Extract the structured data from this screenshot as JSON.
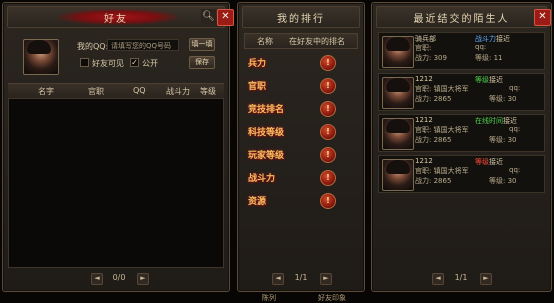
{
  "friends_panel": {
    "title": "好友",
    "search_icon": "search-icon",
    "close_label": "✕",
    "qq_label": "我的QQ:",
    "qq_placeholder": "请填写您的QQ号码",
    "fill_button": "填一填",
    "save_button": "保存",
    "friends_visible_label": "好友可见",
    "public_label": "公开",
    "public_checked": "✓",
    "columns": [
      "名字",
      "官职",
      "QQ",
      "战斗力",
      "等级"
    ],
    "pager": {
      "prev": "◄",
      "text": "0/0",
      "next": "►"
    }
  },
  "ranking_panel": {
    "title": "我的排行",
    "columns": [
      "名称",
      "在好友中的排名"
    ],
    "rows": [
      {
        "label": "兵力",
        "value": "!"
      },
      {
        "label": "官职",
        "value": "!"
      },
      {
        "label": "竞技排名",
        "value": "!"
      },
      {
        "label": "科技等级",
        "value": "!"
      },
      {
        "label": "玩家等级",
        "value": "!"
      },
      {
        "label": "战斗力",
        "value": "!"
      },
      {
        "label": "资源",
        "value": "!"
      }
    ],
    "pager": {
      "prev": "◄",
      "text": "1/1",
      "next": "►"
    }
  },
  "strangers_panel": {
    "title": "最近结交的陌生人",
    "close_label": "✕",
    "cards": [
      {
        "name": "骑兵部",
        "status": "战斗力",
        "status_suffix": "接近",
        "status_color": "#5aa8ff",
        "rank": "官职:",
        "qq": "qq:",
        "power": "战力: 309",
        "level": "等级: 11"
      },
      {
        "name": "1212",
        "status": "等级",
        "status_suffix": "接近",
        "status_color": "#4ed04e",
        "rank": "官职: 镇国大将军",
        "qq": "qq:",
        "power": "战力: 2865",
        "level": "等级: 30"
      },
      {
        "name": "1212",
        "status": "在线时间",
        "status_suffix": "接近",
        "status_color": "#4ed04e",
        "rank": "官职: 镇国大将军",
        "qq": "qq:",
        "power": "战力: 2865",
        "level": "等级: 30"
      },
      {
        "name": "1212",
        "status": "等级",
        "status_suffix": "接近",
        "status_color": "#ff4a3a",
        "rank": "官职: 镇国大将军",
        "qq": "qq:",
        "power": "战力: 2865",
        "level": "等级: 30"
      }
    ],
    "pager": {
      "prev": "◄",
      "text": "1/1",
      "next": "►"
    }
  },
  "bottom": {
    "left": "陈列",
    "right": "好友印象"
  }
}
